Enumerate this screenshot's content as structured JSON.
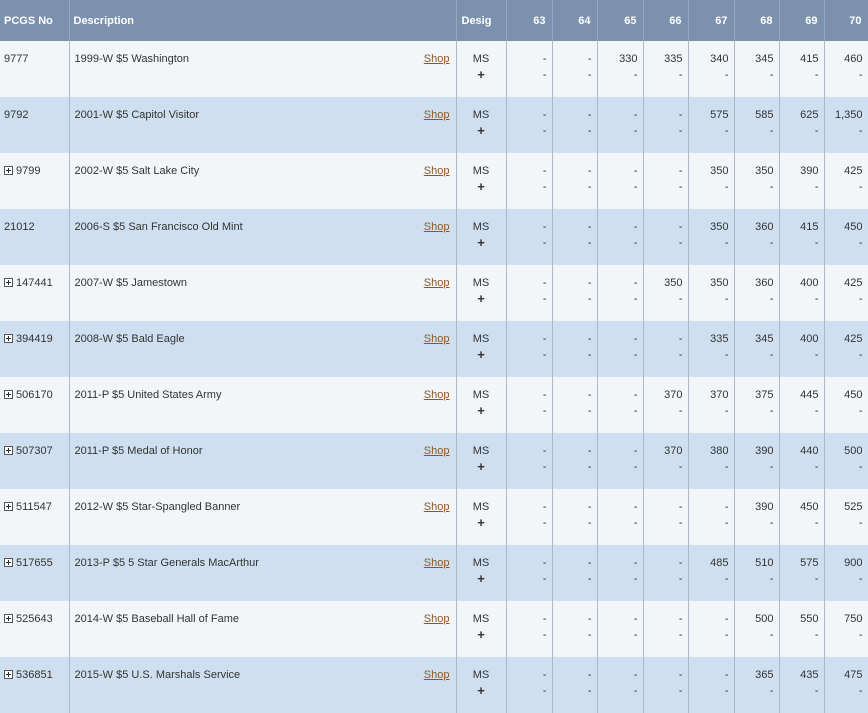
{
  "header": {
    "pcgs_no": "PCGS No",
    "description": "Description",
    "desig": "Desig",
    "grades": [
      "63",
      "64",
      "65",
      "66",
      "67",
      "68",
      "69",
      "70"
    ]
  },
  "shop_label": "Shop",
  "plus_label": "+",
  "rows": [
    {
      "pcgs": "9777",
      "expandable": false,
      "desc": "1999-W $5 Washington",
      "desig": "MS",
      "prices": [
        "-",
        "-",
        "330",
        "335",
        "340",
        "345",
        "415",
        "460"
      ],
      "plus": [
        "-",
        "-",
        "-",
        "-",
        "-",
        "-",
        "-",
        "-"
      ]
    },
    {
      "pcgs": "9792",
      "expandable": false,
      "desc": "2001-W $5 Capitol Visitor",
      "desig": "MS",
      "prices": [
        "-",
        "-",
        "-",
        "-",
        "575",
        "585",
        "625",
        "1,350"
      ],
      "plus": [
        "-",
        "-",
        "-",
        "-",
        "-",
        "-",
        "-",
        "-"
      ]
    },
    {
      "pcgs": "9799",
      "expandable": true,
      "desc": "2002-W $5 Salt Lake City",
      "desig": "MS",
      "prices": [
        "-",
        "-",
        "-",
        "-",
        "350",
        "350",
        "390",
        "425"
      ],
      "plus": [
        "-",
        "-",
        "-",
        "-",
        "-",
        "-",
        "-",
        "-"
      ]
    },
    {
      "pcgs": "21012",
      "expandable": false,
      "desc": "2006-S $5 San Francisco Old Mint",
      "desig": "MS",
      "prices": [
        "-",
        "-",
        "-",
        "-",
        "350",
        "360",
        "415",
        "450"
      ],
      "plus": [
        "-",
        "-",
        "-",
        "-",
        "-",
        "-",
        "-",
        "-"
      ]
    },
    {
      "pcgs": "147441",
      "expandable": true,
      "desc": "2007-W $5 Jamestown",
      "desig": "MS",
      "prices": [
        "-",
        "-",
        "-",
        "350",
        "350",
        "360",
        "400",
        "425"
      ],
      "plus": [
        "-",
        "-",
        "-",
        "-",
        "-",
        "-",
        "-",
        "-"
      ]
    },
    {
      "pcgs": "394419",
      "expandable": true,
      "desc": "2008-W $5 Bald Eagle",
      "desig": "MS",
      "prices": [
        "-",
        "-",
        "-",
        "-",
        "335",
        "345",
        "400",
        "425"
      ],
      "plus": [
        "-",
        "-",
        "-",
        "-",
        "-",
        "-",
        "-",
        "-"
      ]
    },
    {
      "pcgs": "506170",
      "expandable": true,
      "desc": "2011-P $5 United States Army",
      "desig": "MS",
      "prices": [
        "-",
        "-",
        "-",
        "370",
        "370",
        "375",
        "445",
        "450"
      ],
      "plus": [
        "-",
        "-",
        "-",
        "-",
        "-",
        "-",
        "-",
        "-"
      ]
    },
    {
      "pcgs": "507307",
      "expandable": true,
      "desc": "2011-P $5 Medal of Honor",
      "desig": "MS",
      "prices": [
        "-",
        "-",
        "-",
        "370",
        "380",
        "390",
        "440",
        "500"
      ],
      "plus": [
        "-",
        "-",
        "-",
        "-",
        "-",
        "-",
        "-",
        "-"
      ]
    },
    {
      "pcgs": "511547",
      "expandable": true,
      "desc": "2012-W $5 Star-Spangled Banner",
      "desig": "MS",
      "prices": [
        "-",
        "-",
        "-",
        "-",
        "-",
        "390",
        "450",
        "525"
      ],
      "plus": [
        "-",
        "-",
        "-",
        "-",
        "-",
        "-",
        "-",
        "-"
      ]
    },
    {
      "pcgs": "517655",
      "expandable": true,
      "desc": "2013-P $5 5 Star Generals MacArthur",
      "desig": "MS",
      "prices": [
        "-",
        "-",
        "-",
        "-",
        "485",
        "510",
        "575",
        "900"
      ],
      "plus": [
        "-",
        "-",
        "-",
        "-",
        "-",
        "-",
        "-",
        "-"
      ]
    },
    {
      "pcgs": "525643",
      "expandable": true,
      "desc": "2014-W $5 Baseball Hall of Fame",
      "desig": "MS",
      "prices": [
        "-",
        "-",
        "-",
        "-",
        "-",
        "500",
        "550",
        "750"
      ],
      "plus": [
        "-",
        "-",
        "-",
        "-",
        "-",
        "-",
        "-",
        "-"
      ]
    },
    {
      "pcgs": "536851",
      "expandable": true,
      "desc": "2015-W $5 U.S. Marshals Service",
      "desig": "MS",
      "prices": [
        "-",
        "-",
        "-",
        "-",
        "-",
        "365",
        "435",
        "475"
      ],
      "plus": [
        "-",
        "-",
        "-",
        "-",
        "-",
        "-",
        "-",
        "-"
      ]
    }
  ]
}
